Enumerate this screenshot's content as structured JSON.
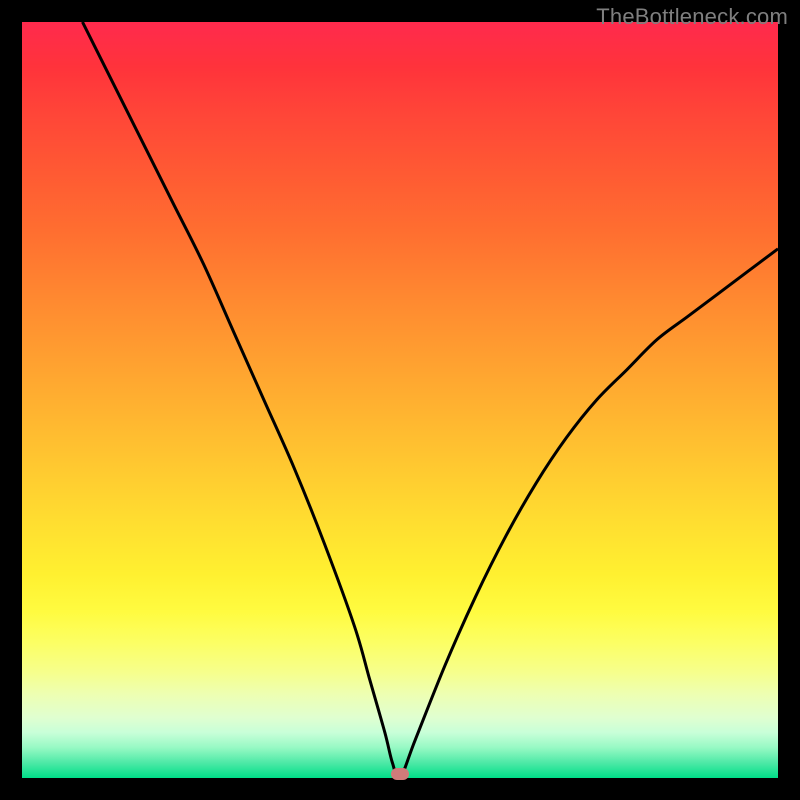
{
  "watermark": "TheBottleneck.com",
  "colors": {
    "line": "#000000",
    "marker": "#cf7b7a",
    "frame": "#000000"
  },
  "chart_data": {
    "type": "line",
    "title": "",
    "xlabel": "",
    "ylabel": "",
    "xlim": [
      0,
      100
    ],
    "ylim": [
      0,
      100
    ],
    "series": [
      {
        "name": "bottleneck-curve",
        "x": [
          8,
          12,
          16,
          20,
          24,
          28,
          32,
          36,
          40,
          44,
          46,
          48,
          49,
          50,
          52,
          56,
          60,
          64,
          68,
          72,
          76,
          80,
          84,
          88,
          92,
          96,
          100
        ],
        "y": [
          100,
          92,
          84,
          76,
          68,
          59,
          50,
          41,
          31,
          20,
          13,
          6,
          2,
          0,
          5,
          15,
          24,
          32,
          39,
          45,
          50,
          54,
          58,
          61,
          64,
          67,
          70
        ]
      }
    ],
    "marker": {
      "x": 50,
      "y": 0
    },
    "grid": false,
    "legend": false
  }
}
